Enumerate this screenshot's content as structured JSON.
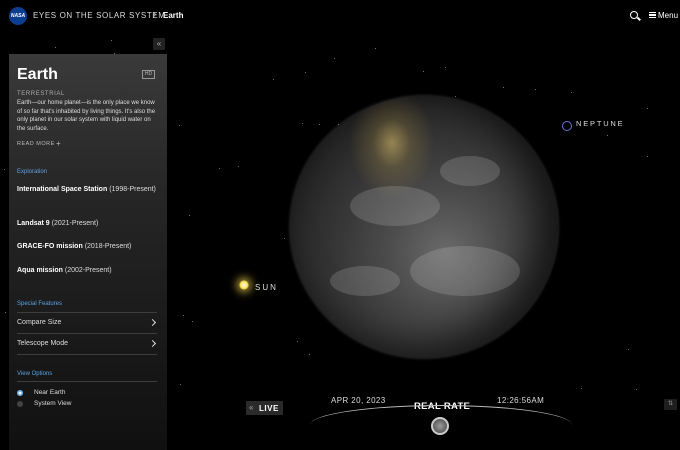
{
  "header": {
    "logo_text": "NASA",
    "app_title": "EYES ON THE SOLAR SYSTEM",
    "separator": "›",
    "breadcrumb": "Earth",
    "menu_label": "Menu",
    "collapse_glyph": "«"
  },
  "panel": {
    "title": "Earth",
    "hd_badge": "HD",
    "subtitle": "TERRESTRIAL",
    "description": "Earth—our home planet—is the only place we know of so far that's inhabited by living things. It's also the only planet in our solar system with liquid water on the surface.",
    "read_more": "READ MORE",
    "read_more_icon": "+",
    "exploration": {
      "heading": "Exploration",
      "items": [
        {
          "name": "International Space Station",
          "years": "(1998-Present)"
        },
        {
          "name": "Landsat 9",
          "years": "(2021-Present)"
        },
        {
          "name": "GRACE-FO mission",
          "years": "(2018-Present)"
        },
        {
          "name": "Aqua mission",
          "years": "(2002-Present)"
        }
      ]
    },
    "special_features": {
      "heading": "Special Features",
      "items": [
        "Compare Size",
        "Telescope Mode"
      ]
    },
    "view_options": {
      "heading": "View Options",
      "items": [
        {
          "label": "Near Earth",
          "selected": true
        },
        {
          "label": "System View",
          "selected": false
        }
      ]
    }
  },
  "scene": {
    "sun_label": "SUN",
    "neptune_label": "NEPTUNE"
  },
  "time_controls": {
    "live_icon": "«",
    "live_label": "LIVE",
    "date": "APR 20, 2023",
    "rate_label": "REAL RATE",
    "time": "12:26:56AM",
    "corner_glyph": "⇅"
  },
  "colors": {
    "accent": "#5aa2e0",
    "nasa_blue": "#0b3d91",
    "neptune_ring": "#6a72d8",
    "sun": "#ffe45a"
  }
}
